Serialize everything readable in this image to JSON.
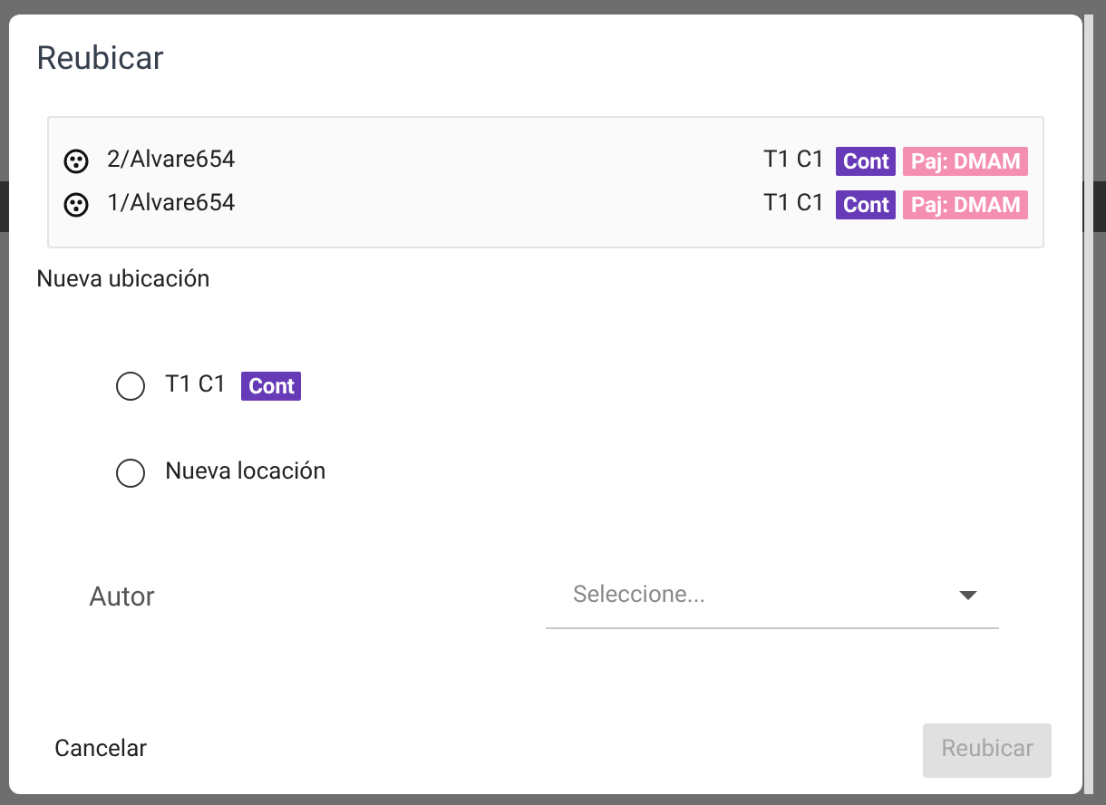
{
  "dialog": {
    "title": "Reubicar",
    "items": [
      {
        "name": "2/Alvare654",
        "location": "T1 C1",
        "tags": [
          {
            "text": "Cont",
            "color": "#673ab7"
          },
          {
            "text": "Paj: DMAM",
            "color": "#f48fb1"
          }
        ]
      },
      {
        "name": "1/Alvare654",
        "location": "T1 C1",
        "tags": [
          {
            "text": "Cont",
            "color": "#673ab7"
          },
          {
            "text": "Paj: DMAM",
            "color": "#f48fb1"
          }
        ]
      }
    ],
    "section_label": "Nueva ubicación",
    "options": [
      {
        "label": "T1 C1",
        "tags": [
          {
            "text": "Cont",
            "color": "#673ab7"
          }
        ],
        "selected": false
      },
      {
        "label": "Nueva locación",
        "selected": false
      }
    ],
    "author": {
      "label": "Autor",
      "placeholder": "Seleccione..."
    },
    "actions": {
      "cancel": {
        "label": "Cancelar"
      },
      "submit": {
        "label": "Reubicar",
        "disabled": true
      }
    }
  }
}
